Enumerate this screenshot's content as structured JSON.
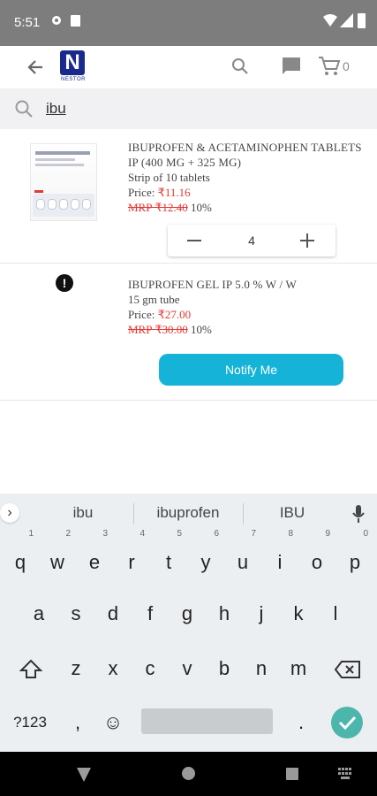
{
  "status_bar": {
    "time": "5:51"
  },
  "app_bar": {
    "logo_letter": "N",
    "logo_word": "NESTOR",
    "cart_count": "0"
  },
  "search": {
    "query": "ibu"
  },
  "products": [
    {
      "name": "IBUPROFEN & ACETAMINOPHEN TABLETS IP (400 MG + 325 MG)",
      "pack": "Strip of 10 tablets",
      "price_label": "Price: ",
      "price": "₹11.16",
      "mrp": "MRP ₹12.40",
      "discount": " 10%",
      "quantity": "4"
    },
    {
      "name": "IBUPROFEN GEL IP 5.0 % W / W",
      "pack": "15 gm tube",
      "price_label": "Price: ",
      "price": "₹27.00",
      "mrp": "MRP ₹30.00",
      "discount": " 10%",
      "alert_glyph": "!",
      "notify_label": "Notify Me"
    }
  ],
  "keyboard": {
    "suggestions": [
      "ibu",
      "ibuprofen",
      "IBU"
    ],
    "row1": [
      "q",
      "w",
      "e",
      "r",
      "t",
      "y",
      "u",
      "i",
      "o",
      "p"
    ],
    "row1_hints": [
      "1",
      "2",
      "3",
      "4",
      "5",
      "6",
      "7",
      "8",
      "9",
      "0"
    ],
    "row2": [
      "a",
      "s",
      "d",
      "f",
      "g",
      "h",
      "j",
      "k",
      "l"
    ],
    "row3": [
      "z",
      "x",
      "c",
      "v",
      "b",
      "n",
      "m"
    ],
    "symbols_label": "?123",
    "comma": ",",
    "period": ".",
    "emoji": "☺"
  }
}
